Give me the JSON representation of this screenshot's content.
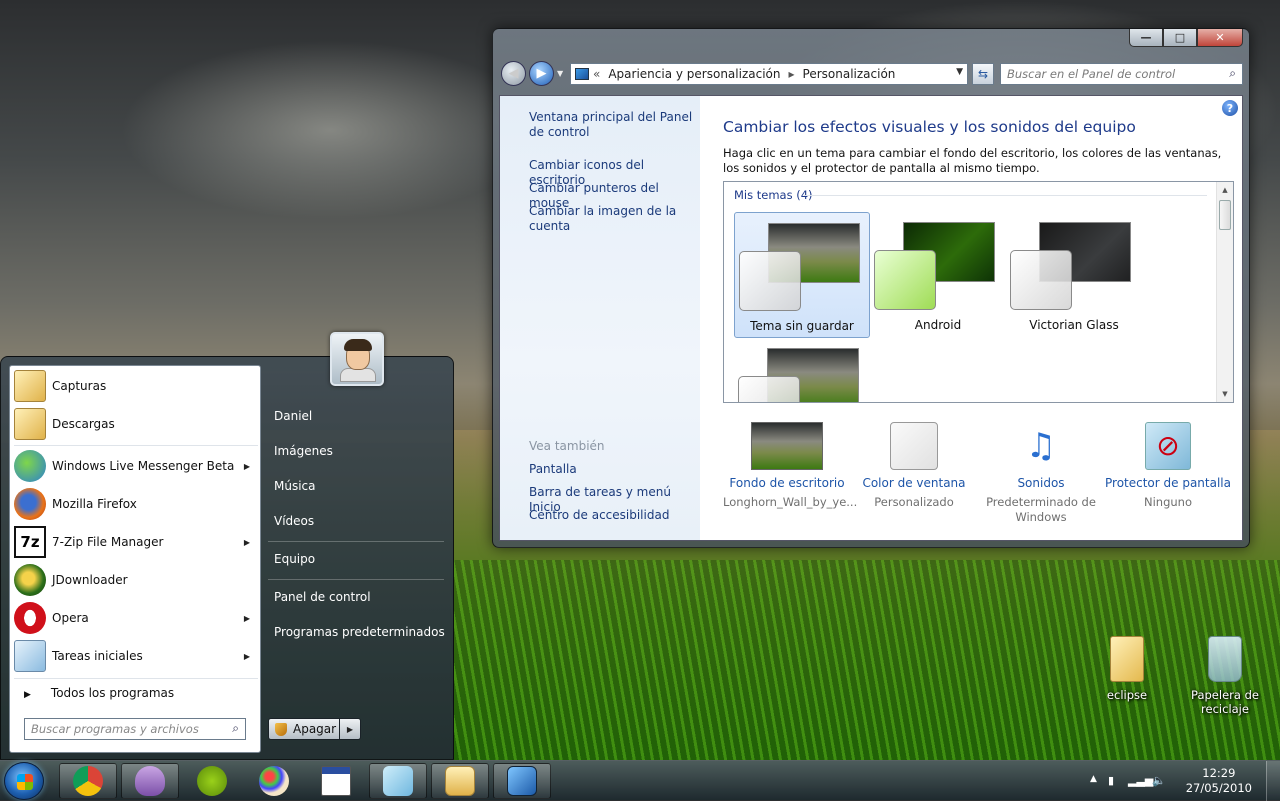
{
  "window": {
    "controls": {
      "minimize": "—",
      "maximize": "□",
      "close": "✕"
    },
    "address": {
      "chevrons": "«",
      "segments": [
        "Apariencia y personalización",
        "Personalización"
      ],
      "separator": "▸"
    },
    "search_placeholder": "Buscar en el Panel de control",
    "sidebar": {
      "links": [
        "Ventana principal del Panel de control",
        "Cambiar iconos del escritorio",
        "Cambiar punteros del mouse",
        "Cambiar la imagen de la cuenta"
      ],
      "see_also_title": "Vea también",
      "see_also": [
        "Pantalla",
        "Barra de tareas y menú Inicio",
        "Centro de accesibilidad"
      ]
    },
    "main": {
      "title": "Cambiar los efectos visuales y los sonidos del equipo",
      "description": "Haga clic en un tema para cambiar el fondo del escritorio, los colores de las ventanas, los sonidos y el protector de pantalla al mismo tiempo.",
      "themes_header": "Mis temas (4)",
      "themes": [
        {
          "name": "Tema sin guardar",
          "selected": true
        },
        {
          "name": "Android",
          "selected": false
        },
        {
          "name": "Victorian Glass",
          "selected": false
        },
        {
          "name": "",
          "selected": false
        }
      ],
      "settings": [
        {
          "label": "Fondo de escritorio",
          "value": "Longhorn_Wall_by_ye...",
          "icon": "wallpaper-icon"
        },
        {
          "label": "Color de ventana",
          "value": "Personalizado",
          "icon": "window-color-icon"
        },
        {
          "label": "Sonidos",
          "value": "Predeterminado de Windows",
          "icon": "music-notes-icon"
        },
        {
          "label": "Protector de pantalla",
          "value": "Ninguno",
          "icon": "screensaver-icon"
        }
      ]
    }
  },
  "start_menu": {
    "programs": [
      {
        "label": "Capturas",
        "icon": "folder-icon",
        "submenu": false
      },
      {
        "label": "Descargas",
        "icon": "folder-icon",
        "submenu": false
      },
      {
        "label": "Windows Live Messenger Beta",
        "icon": "messenger-icon",
        "submenu": true
      },
      {
        "label": "Mozilla Firefox",
        "icon": "firefox-icon",
        "submenu": false
      },
      {
        "label": "7-Zip File Manager",
        "icon": "7zip-icon",
        "submenu": true
      },
      {
        "label": "JDownloader",
        "icon": "jdownloader-icon",
        "submenu": false
      },
      {
        "label": "Opera",
        "icon": "opera-icon",
        "submenu": true
      },
      {
        "label": "Tareas iniciales",
        "icon": "getting-started-icon",
        "submenu": true
      }
    ],
    "all_programs": "Todos los programas",
    "search_placeholder": "Buscar programas y archivos",
    "right": [
      "Daniel",
      "Imágenes",
      "Música",
      "Vídeos",
      "Equipo",
      "Panel de control",
      "Programas predeterminados"
    ],
    "shutdown": "Apagar"
  },
  "desktop": {
    "icons": [
      {
        "label": "eclipse",
        "icon": "folder-icon"
      },
      {
        "label": "Papelera de reciclaje",
        "icon": "recycle-bin-icon"
      }
    ]
  },
  "taskbar": {
    "time": "12:29",
    "date": "27/05/2010",
    "tray_arrow": "▲"
  },
  "colors": {
    "link": "#1b3a7a",
    "title": "#1e3a8a",
    "accent": "#1d5fb0"
  }
}
